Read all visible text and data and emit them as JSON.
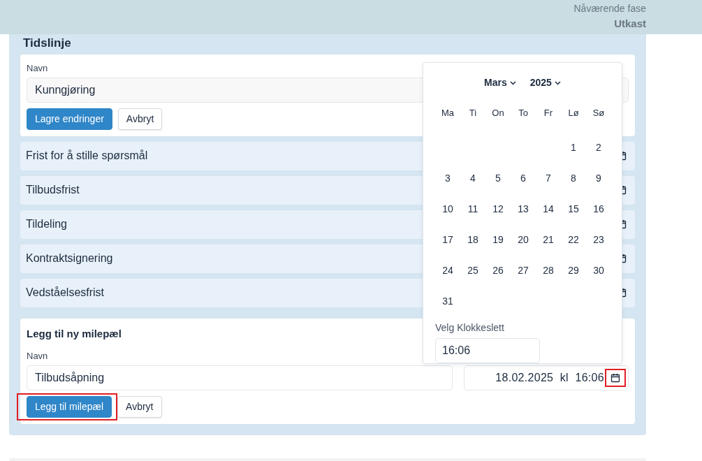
{
  "header": {
    "phase_label": "Nåværende fase",
    "phase": "Utkast"
  },
  "timeline": {
    "title": "Tidslinje",
    "edit_form": {
      "label": "Navn",
      "value": "Kunngjøring",
      "buttons": [
        {
          "label": "Lagre endringer",
          "kind": "primary",
          "highlighted": false
        },
        {
          "label": "Avbryt",
          "kind": "secondary",
          "highlighted": false
        }
      ]
    },
    "milestones": [
      {
        "name": "Frist for å stille spørsmål"
      },
      {
        "name": "Tilbudsfrist"
      },
      {
        "name": "Tildeling"
      },
      {
        "name": "Kontraktsignering"
      },
      {
        "name": "Vedståelsesfrist"
      }
    ],
    "new_milestone": {
      "title": "Legg til ny milepæl",
      "label": "Navn",
      "value": "Tilbudsåpning",
      "date_value": "18.02.2025  kl  16:06",
      "calendar_highlighted": true,
      "buttons": [
        {
          "label": "Legg til milepæl",
          "kind": "primary",
          "highlighted": true
        },
        {
          "label": "Avbryt",
          "kind": "secondary",
          "highlighted": false
        }
      ]
    }
  },
  "date_picker": {
    "month": "Mars",
    "year": "2025",
    "weekdays": [
      "Ma",
      "Ti",
      "On",
      "To",
      "Fr",
      "Lø",
      "Sø"
    ],
    "weeks": [
      {
        "align_end": true,
        "days": [
          "1",
          "2"
        ]
      },
      {
        "days": [
          "3",
          "4",
          "5",
          "6",
          "7",
          "8",
          "9"
        ]
      },
      {
        "days": [
          "10",
          "11",
          "12",
          "13",
          "14",
          "15",
          "16"
        ]
      },
      {
        "days": [
          "17",
          "18",
          "19",
          "20",
          "21",
          "22",
          "23"
        ]
      },
      {
        "days": [
          "24",
          "25",
          "26",
          "27",
          "28",
          "29",
          "30"
        ]
      },
      {
        "align_end": false,
        "days": [
          "31"
        ]
      }
    ],
    "time_label": "Velg Klokkeslett",
    "time": "16:06"
  }
}
